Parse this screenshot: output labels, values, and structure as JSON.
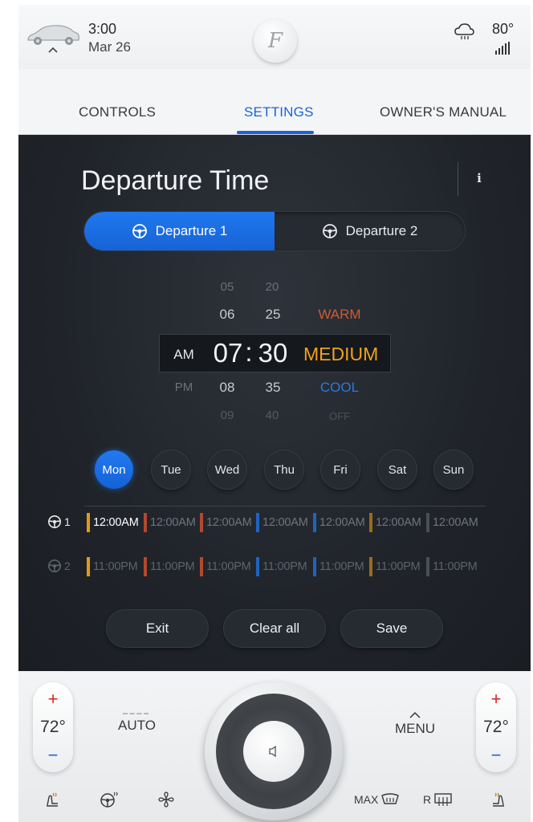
{
  "status": {
    "time": "3:00",
    "date": "Mar 26",
    "logo_letter": "F",
    "outside_temp": "80°"
  },
  "tabs": [
    {
      "label": "CONTROLS"
    },
    {
      "label": "SETTINGS",
      "active": true
    },
    {
      "label": "OWNER'S MANUAL"
    }
  ],
  "page": {
    "title": "Departure Time",
    "info_label": "i"
  },
  "segments": [
    {
      "label": "Departure 1",
      "active": true
    },
    {
      "label": "Departure 2",
      "active": false
    }
  ],
  "picker": {
    "ampm": {
      "selected": "AM",
      "below": "PM"
    },
    "hours": {
      "above2": "05",
      "above1": "06",
      "selected": "07",
      "below1": "08",
      "below2": "09"
    },
    "separator": ":",
    "minutes": {
      "above2": "20",
      "above1": "25",
      "selected": "30",
      "below1": "35",
      "below2": "40"
    },
    "temperature": {
      "above1": "WARM",
      "selected": "MEDIUM",
      "below1": "COOL",
      "below2": "OFF"
    }
  },
  "days": [
    "Mon",
    "Tue",
    "Wed",
    "Thu",
    "Fri",
    "Sat",
    "Sun"
  ],
  "active_day": "Mon",
  "schedule": {
    "row1_label": "1",
    "row2_label": "2",
    "row1": [
      "12:00AM",
      "12:00AM",
      "12:00AM",
      "12:00AM",
      "12:00AM",
      "12:00AM",
      "12:00AM"
    ],
    "row2": [
      "11:00PM",
      "11:00PM",
      "11:00PM",
      "11:00PM",
      "11:00PM",
      "11:00PM",
      "11:00PM"
    ],
    "indicator_colors": [
      "#e29a14",
      "#b2492c",
      "#b2492c",
      "#1f63bf",
      "#1f63bf",
      "#9a6c1a",
      "#4a4e55"
    ]
  },
  "actions": {
    "exit": "Exit",
    "clear_all": "Clear all",
    "save": "Save"
  },
  "climate": {
    "plus": "+",
    "minus": "−",
    "left_temp": "72°",
    "right_temp": "72°",
    "auto": "AUTO",
    "menu_chevron": "^",
    "menu": "MENU",
    "max_label": "MAX",
    "rear_label": "R"
  },
  "colors": {
    "accent": "#1b63d6",
    "warm": "#cf5a30",
    "medium": "#f0a21b",
    "cool": "#2f78d6",
    "increase": "#d8262a",
    "decrease": "#2060c8"
  },
  "icons": {
    "status": [
      "car-icon",
      "chevron-up-icon",
      "brand-logo",
      "cloud-weather-icon",
      "signal-strength-icon"
    ],
    "panel": [
      "info-icon",
      "steering-wheel-icon"
    ],
    "climate_bottom": [
      "heated-seat-left-icon",
      "heated-steering-wheel-icon",
      "fan-icon",
      "max-defrost-icon",
      "rear-defrost-icon",
      "heated-seat-right-icon",
      "volume-icon"
    ]
  }
}
